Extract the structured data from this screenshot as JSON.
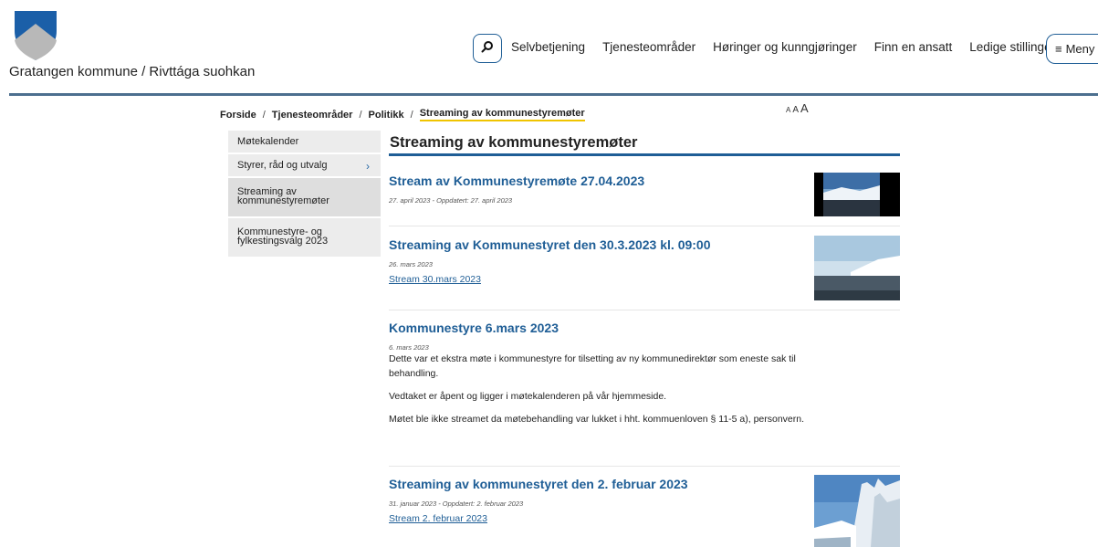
{
  "header": {
    "site_name": "Gratangen kommune / Rivttága suohkan",
    "nav_items": [
      "Selvbetjening",
      "Tjenesteområder",
      "Høringer og kunngjøringer",
      "Finn en ansatt",
      "Ledige stillinger"
    ],
    "menu_label": "Meny",
    "colors": {
      "accent": "#1f5e96",
      "rule": "#4c6f8f",
      "highlight": "#f0c400"
    }
  },
  "breadcrumb": {
    "items": [
      "Forside",
      "Tjenesteområder",
      "Politikk"
    ],
    "current": "Streaming av kommunestyremøter",
    "separator": "/"
  },
  "textsize": {
    "small": "A",
    "medium": "A",
    "large": "A"
  },
  "sidebar": {
    "items": [
      {
        "label": "Møtekalender"
      },
      {
        "label": "Styrer, råd og utvalg"
      },
      {
        "label": "Streaming av kommunestyremøter"
      },
      {
        "label": "Kommunestyre- og fylkestingsvalg 2023"
      }
    ]
  },
  "main": {
    "title": "Streaming av kommunestyremøter",
    "articles": [
      {
        "title": "Stream av Kommunestyremøte 27.04.2023",
        "meta": "27. april 2023 - Oppdatert: 27. april 2023"
      },
      {
        "title": "Streaming av Kommunestyret den 30.3.2023 kl. 09:00",
        "meta": "26. mars 2023",
        "link": "Stream 30.mars 2023"
      },
      {
        "title": "Kommunestyre 6.mars 2023",
        "meta": "6. mars 2023",
        "paragraphs": [
          "Dette var et ekstra møte i kommunestyre for tilsetting av ny kommunedirektør som eneste sak til behandling.",
          "Vedtaket er åpent og ligger i møtekalenderen på vår hjemmeside.",
          "Møtet ble ikke streamet da møtebehandling var lukket i hht. kommuenloven § 11-5 a), personvern."
        ]
      },
      {
        "title": "Streaming av kommunestyret den 2. februar 2023",
        "meta": "31. januar 2023 - Oppdatert: 2. februar 2023",
        "link": "Stream 2. februar 2023"
      }
    ]
  }
}
